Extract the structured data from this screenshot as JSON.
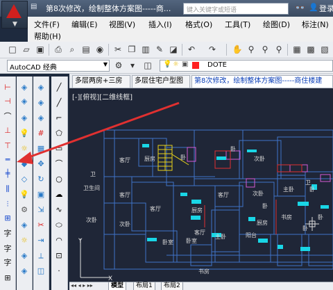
{
  "title_bar": {
    "document_title": "第8次修改，绘制整体方案图-----商...",
    "search_placeholder": "键入关键字或短语",
    "login_label": "登录"
  },
  "menu": {
    "items": [
      "文件(F)",
      "编辑(E)",
      "视图(V)",
      "插入(I)",
      "格式(O)",
      "工具(T)",
      "绘图(D)",
      "标注(N)",
      "帮助(H)"
    ]
  },
  "toolbar2": {
    "workspace": "AutoCAD 经典",
    "layer_name": "DOTE"
  },
  "doc_tabs": [
    {
      "label": "多层两房+三房",
      "active": false
    },
    {
      "label": "多层住宅户型图",
      "active": false
    },
    {
      "label": "第8次修改，绘制整体方案图-----商住楼建",
      "active": true
    }
  ],
  "canvas": {
    "view_label": "[-][俯视][二维线框]",
    "room_labels": [
      "卫生间",
      "厨房",
      "客厅",
      "次卧",
      "客厅",
      "次卧",
      "次卧",
      "客厅",
      "厨房",
      "卧",
      "主卧",
      "卧",
      "书房",
      "阳台",
      "卧",
      "客厅",
      "次卧",
      "主卧",
      "厨房",
      "客厅",
      "卧室",
      "卧室",
      "书房",
      "卫",
      "卧",
      "卧",
      "卧",
      "卫"
    ]
  },
  "layout_tabs": [
    {
      "label": "模型",
      "active": true
    },
    {
      "label": "布局1",
      "active": false
    },
    {
      "label": "布局2",
      "active": false
    }
  ],
  "colors": {
    "canvas_bg": "#1f2637",
    "wall_lines": "#3f74c9",
    "furniture": "#19d6e6",
    "annotation_arrow": "#e03030"
  }
}
